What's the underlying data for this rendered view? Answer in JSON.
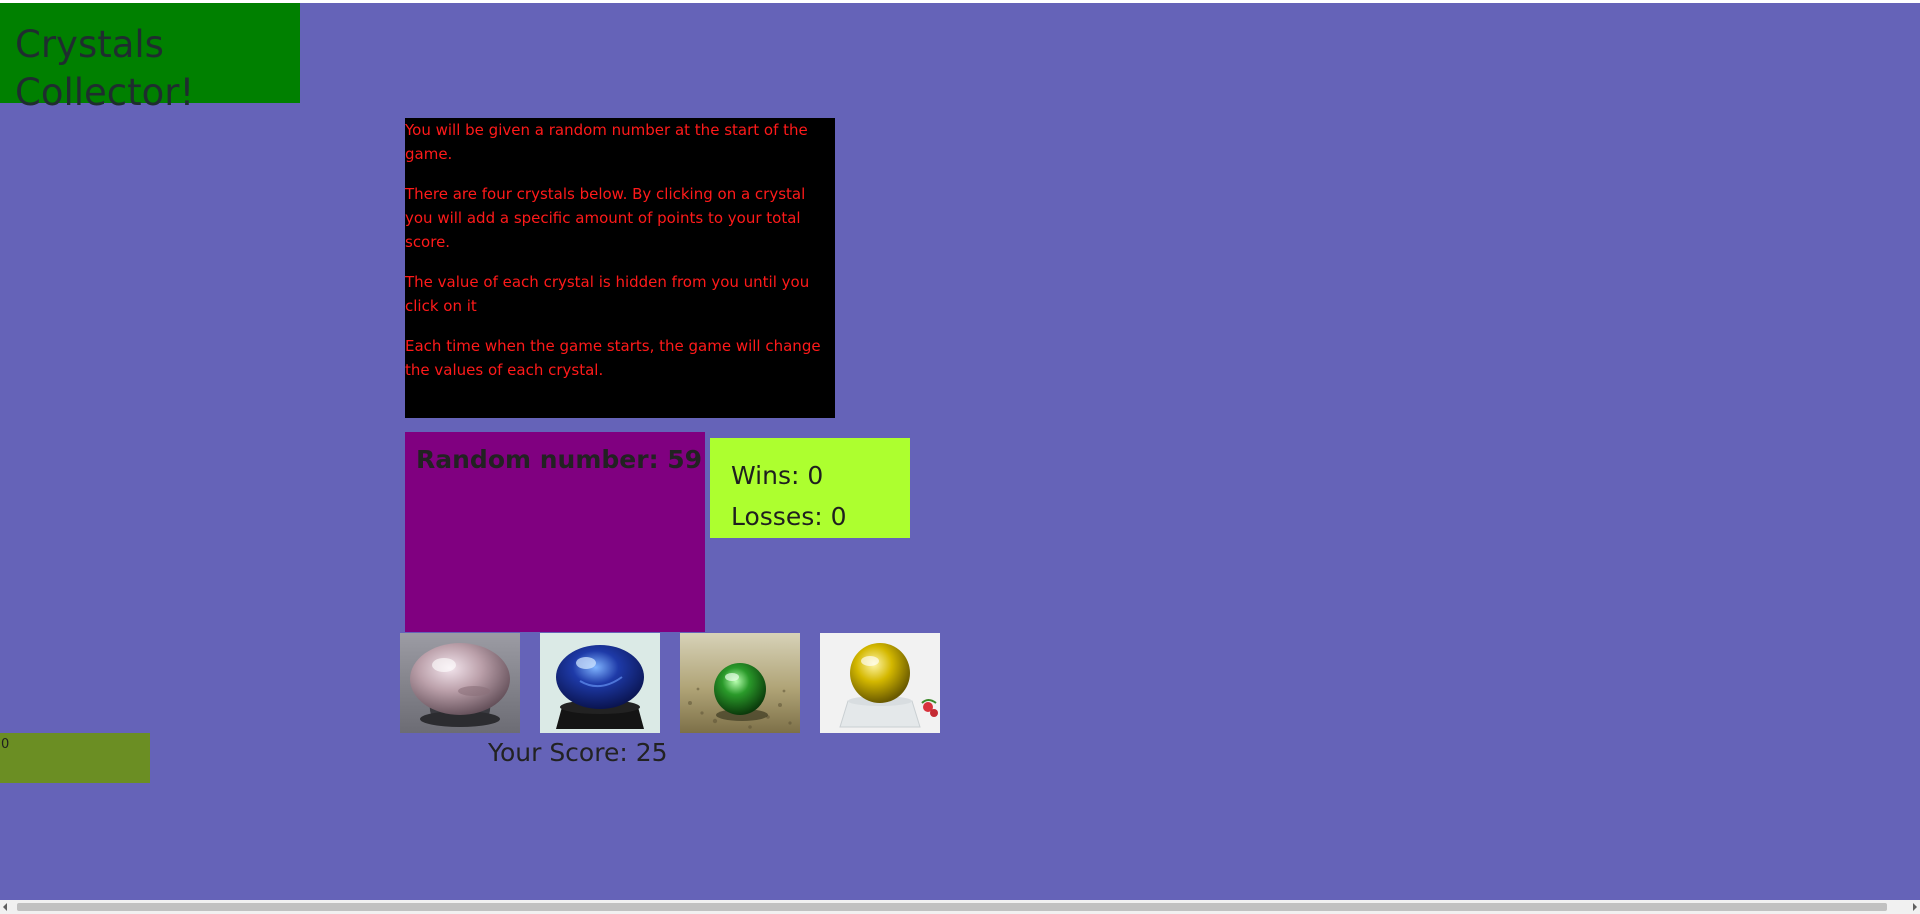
{
  "header": {
    "title": "Crystals Collector!"
  },
  "instructions": [
    "You will be given a random number at the start of the game.",
    "There are four crystals below. By clicking on a crystal you will add a specific amount of points to your total score.",
    "The value of each crystal is hidden from you until you click on it",
    "Each time when the game starts, the game will change the values of each crystal."
  ],
  "game": {
    "random_number_text": "Random number: 59",
    "wins_text": "Wins: 0",
    "losses_text": "Losses: 0",
    "score_text": "Your Score: 25",
    "counter_value": "0"
  },
  "crystals": [
    {
      "name": "purple-crystal-ball",
      "color": "#bba0aa"
    },
    {
      "name": "blue-crystal-ball",
      "color": "#1e3aa8"
    },
    {
      "name": "green-crystal-ball",
      "color": "#2a9a2a"
    },
    {
      "name": "yellow-crystal-ball",
      "color": "#d4b800"
    }
  ],
  "colors": {
    "page_background": "#6563b8",
    "title_background": "#008000",
    "instructions_background": "#000000",
    "instructions_text": "#ff1a1a",
    "random_box_background": "#800080",
    "stats_background": "#adff2f",
    "counter_background": "#6b8e23"
  }
}
